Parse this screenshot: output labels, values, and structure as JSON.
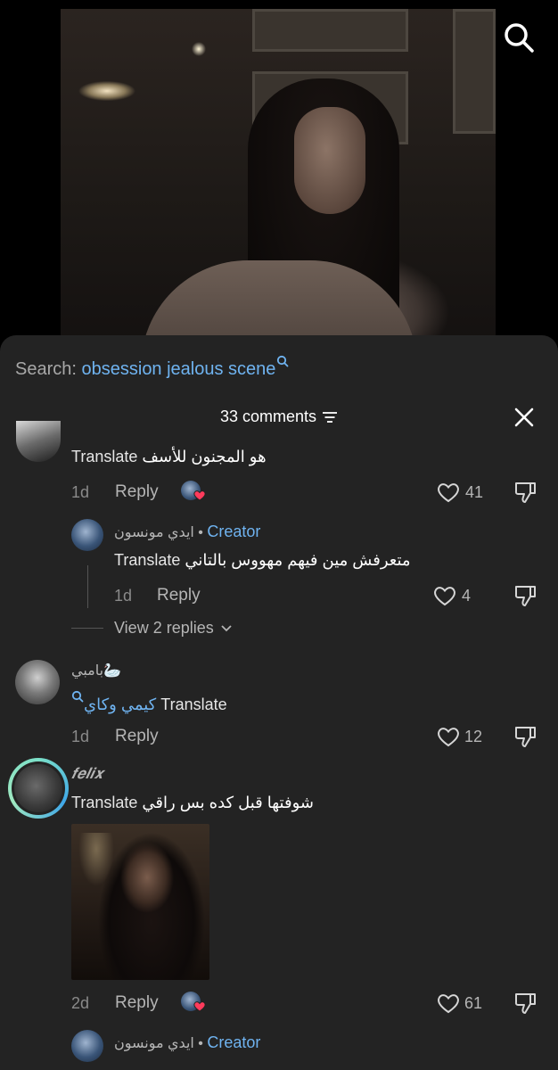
{
  "search": {
    "label": "Search:",
    "term": "obsession jealous scene"
  },
  "comments_header": {
    "count_label": "33 comments"
  },
  "comments": [
    {
      "text_ar": "هو المجنون للأسف",
      "translate": "Translate",
      "age": "1d",
      "reply": "Reply",
      "likes": "41"
    },
    {
      "author": "ايدي مونسون",
      "badge": "Creator",
      "text_ar": "متعرفش مين فيهم مهووس بالتاني",
      "translate": "Translate",
      "age": "1d",
      "reply": "Reply",
      "likes": "4"
    },
    {
      "view_replies": "View 2 replies"
    },
    {
      "author": "بامبي🦢",
      "text_ar": "كيمي وكاي",
      "translate": "Translate",
      "age": "1d",
      "reply": "Reply",
      "likes": "12"
    },
    {
      "author": "𝒇𝒆𝒍𝒊𝒙",
      "text_ar": "شوفتها قبل كده بس راقي",
      "translate": "Translate",
      "age": "2d",
      "reply": "Reply",
      "likes": "61"
    },
    {
      "author": "ايدي مونسون",
      "badge": "Creator"
    }
  ],
  "colors": {
    "accent": "#6fb3f0",
    "sheet": "#232323",
    "like_heart": "#ff3b5c"
  }
}
